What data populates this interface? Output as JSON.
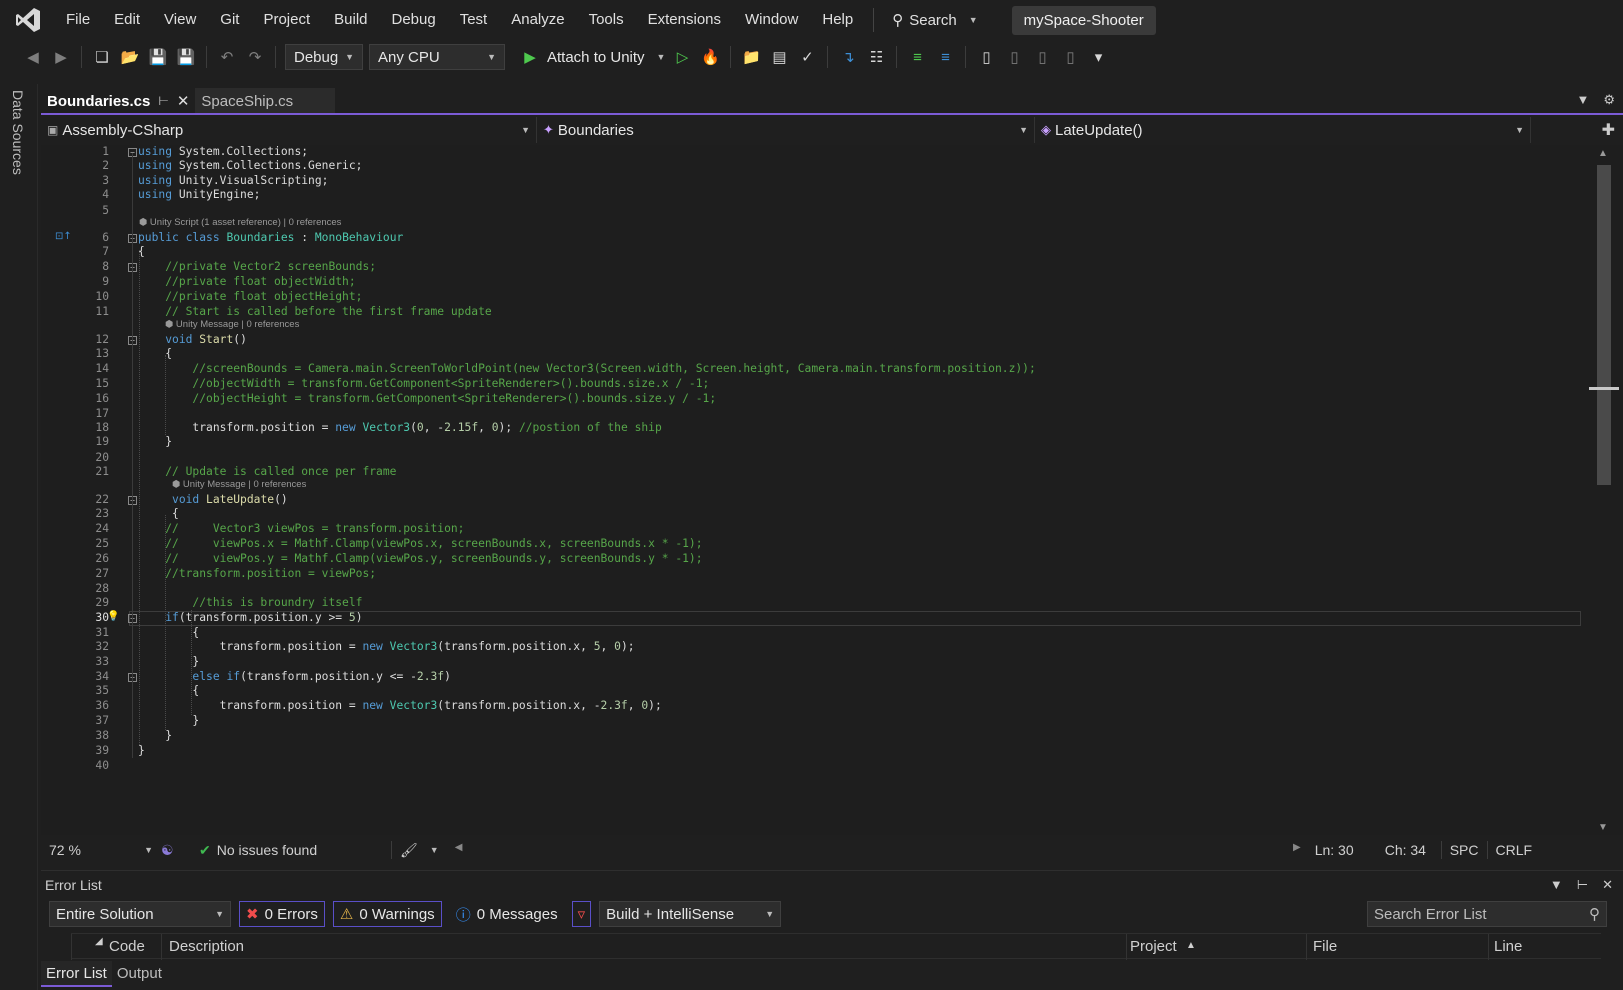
{
  "menu": {
    "items": [
      "File",
      "Edit",
      "View",
      "Git",
      "Project",
      "Build",
      "Debug",
      "Test",
      "Analyze",
      "Tools",
      "Extensions",
      "Window",
      "Help"
    ],
    "search_label": "Search",
    "solution_name": "mySpace-Shooter"
  },
  "toolbar": {
    "config": "Debug",
    "platform": "Any CPU",
    "attach_label": "Attach to Unity"
  },
  "left_tab": {
    "label": "Data Sources"
  },
  "tabs": [
    {
      "label": "Boundaries.cs",
      "active": true
    },
    {
      "label": "SpaceShip.cs",
      "active": false
    }
  ],
  "navbar": {
    "project": "Assembly-CSharp",
    "type": "Boundaries",
    "member": "LateUpdate()"
  },
  "code": {
    "current_line": 30,
    "lines": [
      "using System.Collections;",
      "using System.Collections.Generic;",
      "using Unity.VisualScripting;",
      "using UnityEngine;",
      "",
      "public class Boundaries : MonoBehaviour",
      "{",
      "    //private Vector2 screenBounds;",
      "    //private float objectWidth;",
      "    //private float objectHeight;",
      "    // Start is called before the first frame update",
      "    void Start()",
      "    {",
      "        //screenBounds = Camera.main.ScreenToWorldPoint(new Vector3(Screen.width, Screen.height, Camera.main.transform.position.z));",
      "        //objectWidth = transform.GetComponent<SpriteRenderer>().bounds.size.x / -1;",
      "        //objectHeight = transform.GetComponent<SpriteRenderer>().bounds.size.y / -1;",
      "",
      "        transform.position = new Vector3(0, -2.15f, 0); //postion of the ship",
      "    }",
      "",
      "    // Update is called once per frame",
      "     void LateUpdate()",
      "     {",
      "    //     Vector3 viewPos = transform.position;",
      "    //     viewPos.x = Mathf.Clamp(viewPos.x, screenBounds.x, screenBounds.x * -1);",
      "    //     viewPos.y = Mathf.Clamp(viewPos.y, screenBounds.y, screenBounds.y * -1);",
      "    //transform.position = viewPos;",
      "",
      "        //this is broundry itself",
      "    if(transform.position.y >= 5)",
      "        {",
      "            transform.position = new Vector3(transform.position.x, 5, 0);",
      "        }",
      "        else if(transform.position.y <= -2.3f)",
      "        {",
      "            transform.position = new Vector3(transform.position.x, -2.3f, 0);",
      "        }",
      "    }",
      "}",
      ""
    ],
    "lenses": {
      "class": "Unity Script (1 asset reference) | 0 references",
      "start": "Unity Message | 0 references",
      "lateupdate": "Unity Message | 0 references"
    }
  },
  "editor_status": {
    "zoom": "72 %",
    "issues": "No issues found",
    "line": "Ln: 30",
    "col": "Ch: 34",
    "spacing": "SPC",
    "eol": "CRLF"
  },
  "error_list": {
    "title": "Error List",
    "scope": "Entire Solution",
    "errors": "0 Errors",
    "warnings": "0 Warnings",
    "messages": "0 Messages",
    "source": "Build + IntelliSense",
    "search_placeholder": "Search Error List",
    "columns": {
      "code": "Code",
      "description": "Description",
      "project": "Project",
      "file": "File",
      "line": "Line"
    },
    "bottom_tabs": [
      "Error List",
      "Output"
    ]
  },
  "colors": {
    "accent": "#7b5bd6",
    "keyword": "#569cd6",
    "type": "#4ec9b0",
    "comment": "#57a64a",
    "number": "#b5cea8",
    "method": "#dcdcaa"
  }
}
